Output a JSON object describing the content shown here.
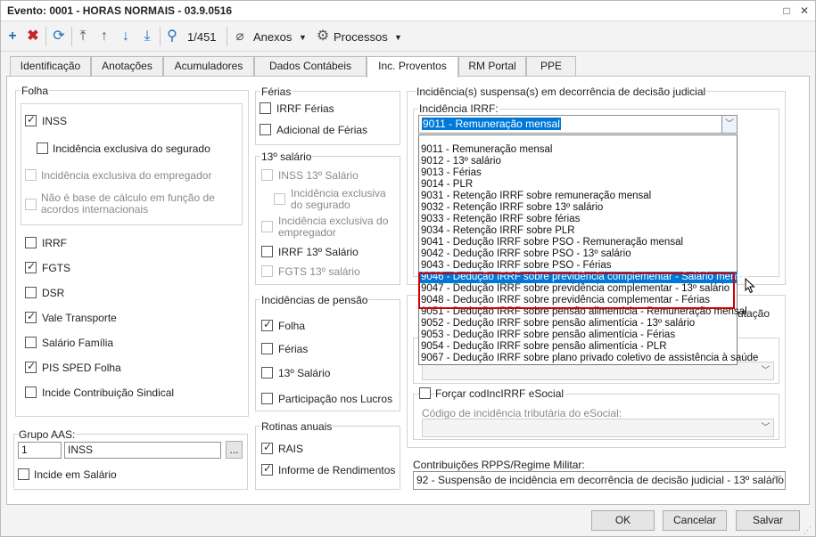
{
  "window": {
    "title": "Evento: 0001 - HORAS NORMAIS - 03.9.0516"
  },
  "toolbar": {
    "record_pos": "1/451",
    "anexos": "Anexos",
    "processos": "Processos"
  },
  "tabs": [
    "Identificação",
    "Anotações",
    "Acumuladores",
    "Dados Contábeis",
    "Inc. Proventos",
    "RM Portal",
    "PPE"
  ],
  "folha": {
    "title": "Folha",
    "inss": "INSS",
    "inc_segurado": "Incidência exclusiva do segurado",
    "inc_empregador": "Incidência exclusiva do empregador",
    "nao_base": "Não é base de cálculo em função de acordos internacionais",
    "irrf": "IRRF",
    "fgts": "FGTS",
    "dsr": "DSR",
    "vale_transporte": "Vale Transporte",
    "salario_familia": "Salário Família",
    "pis_sped": "PIS SPED Folha",
    "contrib_sindical": "Incide Contribuição Sindical"
  },
  "grupo_aas": {
    "title": "Grupo AAS:",
    "code": "1",
    "name": "INSS",
    "browse": "...",
    "incide_salario": "Incide em Salário"
  },
  "ferias": {
    "title": "Férias",
    "irrf_ferias": "IRRF Férias",
    "adicional": "Adicional de Férias"
  },
  "decimo": {
    "title": "13º salário",
    "inss13": "INSS 13º Salário",
    "inc_segurado": "Incidência exclusiva do segurado",
    "inc_empregador": "Incidência exclusiva do empregador",
    "irrf13": "IRRF 13º Salário",
    "fgts13": "FGTS 13º salário"
  },
  "pensao": {
    "title": "Incidências de pensão",
    "folha": "Folha",
    "ferias": "Férias",
    "decimo": "13º Salário",
    "lucros": "Participação nos Lucros"
  },
  "rotinas": {
    "title": "Rotinas anuais",
    "rais": "RAIS",
    "informe": "Informe de Rendimentos"
  },
  "suspensa": {
    "title": "Incidência(s) suspensa(s) em decorrência de decisão judicial",
    "irrf_label": "Incidência IRRF:",
    "irrf_value": "9011 - Remuneração mensal",
    "options": [
      "9011 - Remuneração mensal",
      "9012 - 13º salário",
      "9013 - Férias",
      "9014 - PLR",
      "9031 - Retenção IRRF sobre remuneração mensal",
      "9032 - Retenção IRRF sobre 13º salário",
      "9033 - Retenção IRRF sobre férias",
      "9034 - Retenção IRRF sobre PLR",
      "9041 - Dedução IRRF sobre PSO - Remuneração mensal",
      "9042 - Dedução IRRF sobre PSO - 13º salário",
      "9043 - Dedução IRRF sobre PSO - Férias",
      "9046 - Dedução IRRF sobre previdência complementar - Salário mensal",
      "9047 - Dedução IRRF sobre previdência complementar - 13º salário",
      "9048 - Dedução IRRF sobre previdência complementar - Férias",
      "9051 - Dedução IRRF sobre pensão alimentícia - Remuneração mensal",
      "9052 - Dedução IRRF sobre pensão alimentícia - 13º salário",
      "9053 - Dedução IRRF sobre pensão alimentícia - Férias",
      "9054 - Dedução IRRF sobre pensão alimentícia - PLR",
      "9067 - Dedução IRRF sobre plano privado coletivo de assistência à saúde"
    ],
    "partial_right": "utação"
  },
  "esocial": {
    "forcar": "Forçar codIncIRRF eSocial",
    "codigo_label": "Código de incidência tributária do eSocial:"
  },
  "rpps": {
    "label": "Contribuições RPPS/Regime Militar:",
    "value": "92 - Suspensão de incidência em decorrência de decisão judicial - 13º salário"
  },
  "footer": {
    "ok": "OK",
    "cancelar": "Cancelar",
    "salvar": "Salvar"
  }
}
